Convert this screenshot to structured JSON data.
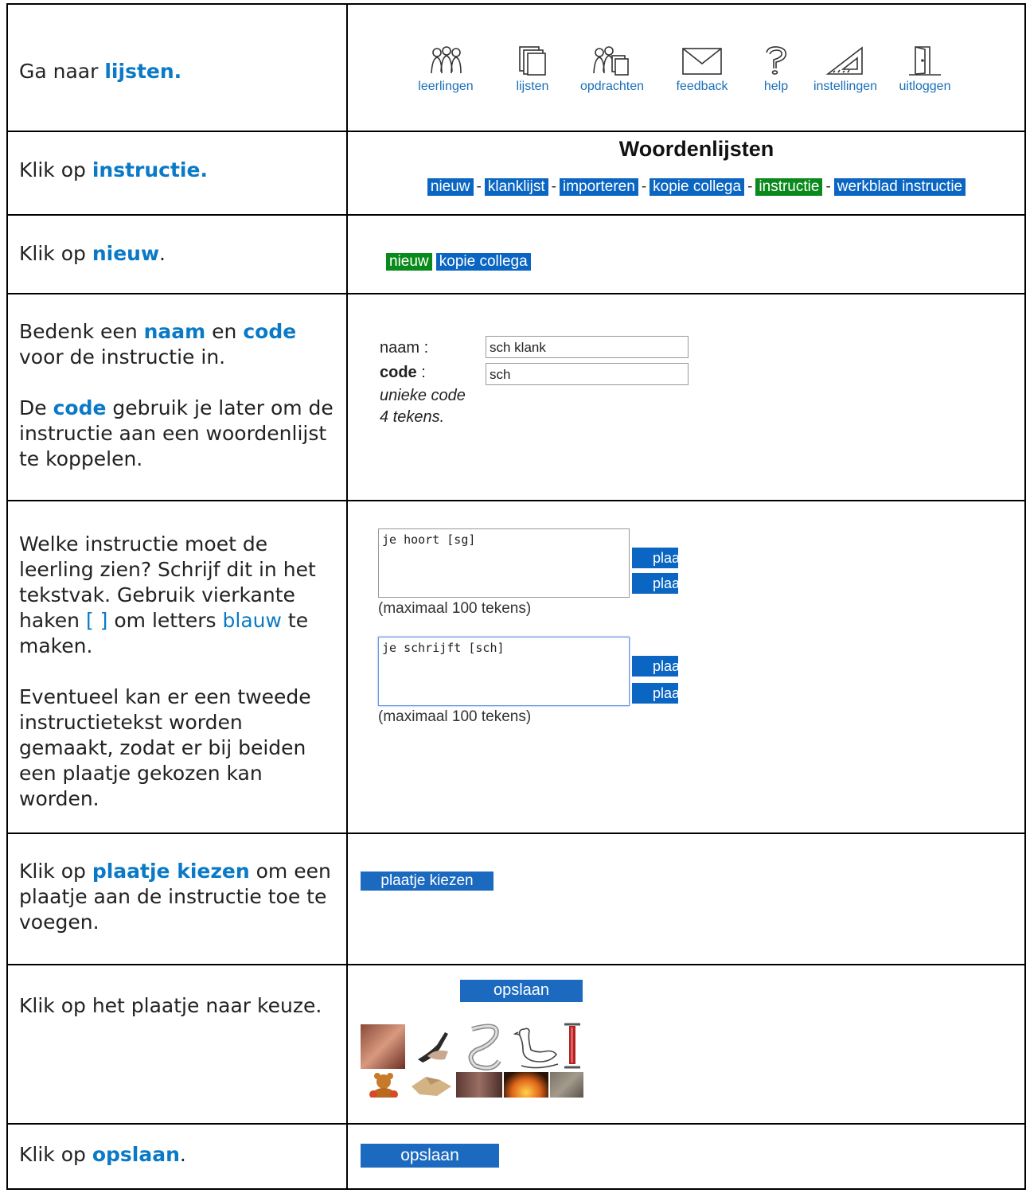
{
  "rows": [
    {
      "pre": "Ga naar ",
      "kw": "lijsten",
      "post": "."
    },
    {
      "pre": "Klik op ",
      "kw": "instructie",
      "post": "."
    },
    {
      "pre": "Klik op ",
      "kw": "nieuw",
      "post": "."
    },
    {
      "p1_pre": "Bedenk een ",
      "p1_kw1": "naam",
      "p1_mid": " en ",
      "p1_kw2": "code",
      "p1_post": " voor de instructie in.",
      "p2_pre": "De ",
      "p2_kw": "code",
      "p2_post": " gebruik je later om de instructie aan een woordenlijst te koppelen."
    },
    {
      "p1_a": "Welke instructie moet de leerling zien? Schrijf dit in het tekstvak. Gebruik vierkante haken ",
      "p1_b": "[ ]",
      "p1_c": " om letters ",
      "p1_d": "blauw",
      "p1_e": " te maken.",
      "p2": "Eventueel kan er een tweede instructietekst worden gemaakt, zodat er bij beiden een plaatje gekozen kan worden."
    },
    {
      "pre": "Klik op ",
      "kw": "plaatje kiezen",
      "post": " om een plaatje aan de instructie toe te voegen."
    },
    {
      "text": "Klik op het plaatje naar keuze."
    },
    {
      "pre": "Klik op ",
      "kw": "opslaan",
      "post": "."
    }
  ],
  "nav": [
    {
      "label": "leerlingen",
      "icon": "students-icon"
    },
    {
      "label": "lijsten",
      "icon": "lists-icon"
    },
    {
      "label": "opdrachten",
      "icon": "assignments-icon"
    },
    {
      "label": "feedback",
      "icon": "envelope-icon"
    },
    {
      "label": "help",
      "icon": "question-icon"
    },
    {
      "label": "instellingen",
      "icon": "set-square-icon"
    },
    {
      "label": "uitloggen",
      "icon": "door-icon"
    }
  ],
  "woordenlijsten": {
    "title": "Woordenlijsten",
    "menu": [
      "nieuw",
      "klanklijst",
      "importeren",
      "kopie collega",
      "instructie",
      "werkblad instructie"
    ],
    "separator": "-",
    "active": "instructie"
  },
  "newbar": [
    "nieuw",
    "kopie collega"
  ],
  "form": {
    "naam_label": "naam :",
    "naam_value": "sch klank",
    "code_label": "code",
    "code_colon": " :",
    "code_value": "sch",
    "hint1": "unieke code",
    "hint2": "4 tekens."
  },
  "instructions": [
    {
      "value": "je hoort [sg]",
      "max": "(maximaal 100 tekens)",
      "btn": "plaatje kiezen"
    },
    {
      "value": "je schrijft [sch]",
      "max": "(maximaal 100 tekens)",
      "btn": "plaatje kiezen"
    }
  ],
  "choose_button": "plaatje kiezen",
  "save_button": "opslaan",
  "thumbnails": [
    "ear",
    "hand-writing",
    "snake-eight",
    "swan",
    "bicycle-pump",
    "teddy-bear",
    "cardboard-box",
    "close-up-photo",
    "fire",
    "mouse"
  ],
  "colors": {
    "accent": "#0a7ac6",
    "button_blue": "#0a66c2",
    "button_green": "#0a8a1a"
  }
}
